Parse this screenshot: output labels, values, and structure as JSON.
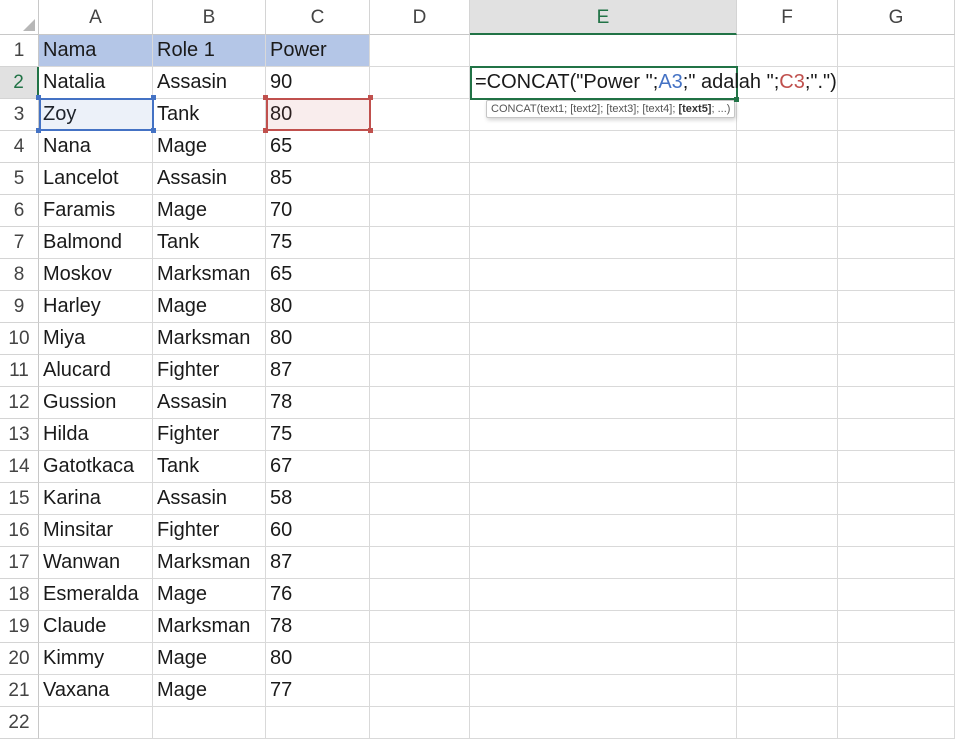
{
  "columns": [
    "A",
    "B",
    "C",
    "D",
    "E",
    "F",
    "G"
  ],
  "selected_column": "E",
  "row_numbers": [
    "1",
    "2",
    "3",
    "4",
    "5",
    "6",
    "7",
    "8",
    "9",
    "10",
    "11",
    "12",
    "13",
    "14",
    "15",
    "16",
    "17",
    "18",
    "19",
    "20",
    "21",
    "22"
  ],
  "selected_row": "2",
  "headers": [
    "Nama",
    "Role 1",
    "Power"
  ],
  "header_fill": "#b4c6e7",
  "rows": [
    [
      "Natalia",
      "Assasin",
      "90"
    ],
    [
      "Zoy",
      "Tank",
      "80"
    ],
    [
      "Nana",
      "Mage",
      "65"
    ],
    [
      "Lancelot",
      "Assasin",
      "85"
    ],
    [
      "Faramis",
      "Mage",
      "70"
    ],
    [
      "Balmond",
      "Tank",
      "75"
    ],
    [
      "Moskov",
      "Marksman",
      "65"
    ],
    [
      "Harley",
      "Mage",
      "80"
    ],
    [
      "Miya",
      "Marksman",
      "80"
    ],
    [
      "Alucard",
      "Fighter",
      "87"
    ],
    [
      "Gussion",
      "Assasin",
      "78"
    ],
    [
      "Hilda",
      "Fighter",
      "75"
    ],
    [
      "Gatotkaca",
      "Tank",
      "67"
    ],
    [
      "Karina",
      "Assasin",
      "58"
    ],
    [
      "Minsitar",
      "Fighter",
      "60"
    ],
    [
      "Wanwan",
      "Marksman",
      "87"
    ],
    [
      "Esmeralda",
      "Mage",
      "76"
    ],
    [
      "Claude",
      "Marksman",
      "78"
    ],
    [
      "Kimmy",
      "Mage",
      "80"
    ],
    [
      "Vaxana",
      "Mage",
      "77"
    ]
  ],
  "formula": {
    "part1": "=CONCAT(\"Power \";",
    "ref1": "A3",
    "part2": ";\" adalah \";",
    "ref2": "C3",
    "part3": ";\".\")"
  },
  "tooltip": {
    "prefix": "CONCAT(text1; [text2]; [text3]; [text4]; ",
    "bold": "[text5]",
    "suffix": "; ...)"
  },
  "colors": {
    "ref_blue": "#4472c4",
    "ref_red": "#c0504d",
    "active_green": "#217346"
  }
}
